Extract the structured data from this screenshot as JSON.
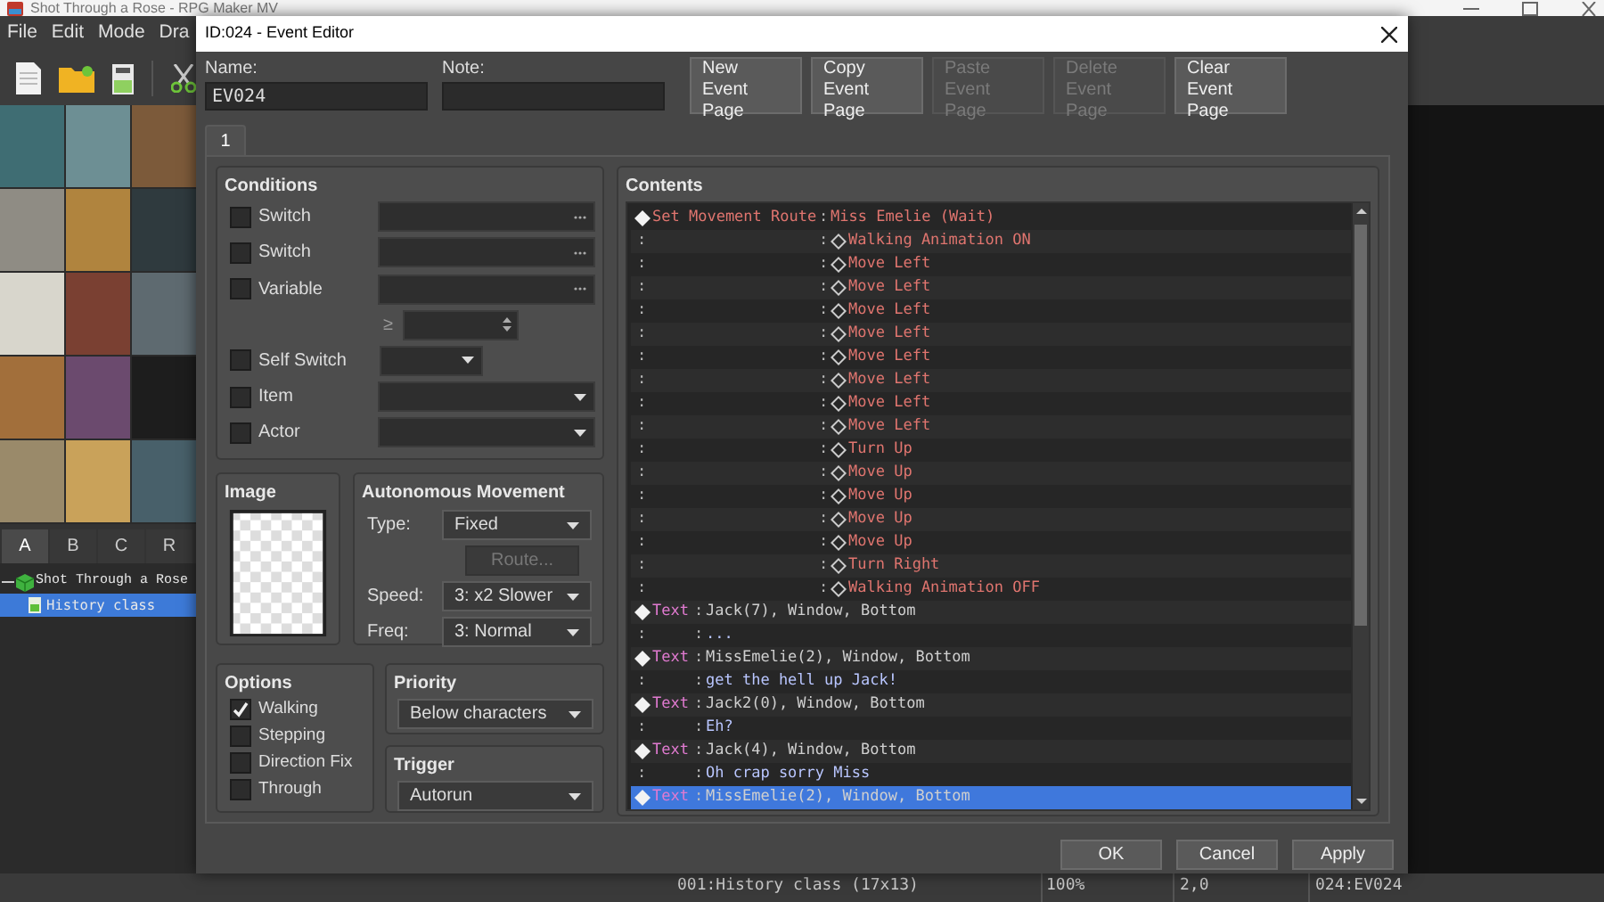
{
  "app": {
    "title": "Shot Through a Rose - RPG Maker MV",
    "menu": [
      "File",
      "Edit",
      "Mode",
      "Dra"
    ],
    "tileset_tabs": [
      {
        "label": "A",
        "selected": true
      },
      {
        "label": "B",
        "selected": false
      },
      {
        "label": "C",
        "selected": false
      },
      {
        "label": "R",
        "selected": false
      }
    ],
    "map_tree": [
      {
        "label": "Shot Through a Rose",
        "expanded": true,
        "selected": false,
        "children": [
          {
            "label": "History class",
            "selected": true
          }
        ]
      }
    ],
    "status_bar": [
      "001:History class (17x13)",
      "100%",
      "2,0",
      "024:EV024"
    ]
  },
  "dialog": {
    "title": "ID:024 - Event Editor",
    "name_label": "Name:",
    "name": "EV024",
    "note_label": "Note:",
    "page_buttons": [
      {
        "label": "New\nEvent Page",
        "disabled": false
      },
      {
        "label": "Copy\nEvent Page",
        "disabled": false
      },
      {
        "label": "Paste\nEvent Page",
        "disabled": true
      },
      {
        "label": "Delete\nEvent Page",
        "disabled": true
      },
      {
        "label": "Clear\nEvent Page",
        "disabled": false
      }
    ],
    "page_tabs": [
      {
        "label": "1",
        "selected": true
      }
    ],
    "conditions": {
      "title": "Conditions",
      "items": [
        {
          "kind": "picker",
          "label": "Switch",
          "checked": false
        },
        {
          "kind": "picker",
          "label": "Switch",
          "checked": false
        },
        {
          "kind": "picker",
          "label": "Variable",
          "checked": false,
          "comparator": "≥"
        },
        {
          "kind": "short_select",
          "label": "Self Switch",
          "checked": false
        },
        {
          "kind": "select",
          "label": "Item",
          "checked": false
        },
        {
          "kind": "select",
          "label": "Actor",
          "checked": false
        }
      ]
    },
    "image": {
      "title": "Image"
    },
    "autonomous_movement": {
      "title": "Autonomous Movement",
      "fields": [
        {
          "kind": "select",
          "label": "Type:",
          "value": "Fixed"
        },
        {
          "kind": "button",
          "label": "Route...",
          "disabled": true
        },
        {
          "kind": "select",
          "label": "Speed:",
          "value": "3: x2 Slower"
        },
        {
          "kind": "select",
          "label": "Freq:",
          "value": "3: Normal"
        }
      ]
    },
    "options": {
      "title": "Options",
      "items": [
        {
          "label": "Walking",
          "checked": true
        },
        {
          "label": "Stepping",
          "checked": false
        },
        {
          "label": "Direction Fix",
          "checked": false
        },
        {
          "label": "Through",
          "checked": false
        }
      ]
    },
    "priority": {
      "title": "Priority",
      "value": "Below characters"
    },
    "trigger": {
      "title": "Trigger",
      "value": "Autorun"
    },
    "contents": {
      "title": "Contents",
      "rows": [
        {
          "kind": "route_header",
          "label": "Set Movement Route",
          "separator": ":",
          "value": "Miss Emelie (Wait)",
          "selected": false
        },
        {
          "kind": "route_step",
          "lead": ":",
          "separator": ":",
          "value": "Walking Animation ON",
          "selected": false
        },
        {
          "kind": "route_step",
          "lead": ":",
          "separator": ":",
          "value": "Move Left",
          "selected": false
        },
        {
          "kind": "route_step",
          "lead": ":",
          "separator": ":",
          "value": "Move Left",
          "selected": false
        },
        {
          "kind": "route_step",
          "lead": ":",
          "separator": ":",
          "value": "Move Left",
          "selected": false
        },
        {
          "kind": "route_step",
          "lead": ":",
          "separator": ":",
          "value": "Move Left",
          "selected": false
        },
        {
          "kind": "route_step",
          "lead": ":",
          "separator": ":",
          "value": "Move Left",
          "selected": false
        },
        {
          "kind": "route_step",
          "lead": ":",
          "separator": ":",
          "value": "Move Left",
          "selected": false
        },
        {
          "kind": "route_step",
          "lead": ":",
          "separator": ":",
          "value": "Move Left",
          "selected": false
        },
        {
          "kind": "route_step",
          "lead": ":",
          "separator": ":",
          "value": "Move Left",
          "selected": false
        },
        {
          "kind": "route_step",
          "lead": ":",
          "separator": ":",
          "value": "Turn Up",
          "selected": false
        },
        {
          "kind": "route_step",
          "lead": ":",
          "separator": ":",
          "value": "Move Up",
          "selected": false
        },
        {
          "kind": "route_step",
          "lead": ":",
          "separator": ":",
          "value": "Move Up",
          "selected": false
        },
        {
          "kind": "route_step",
          "lead": ":",
          "separator": ":",
          "value": "Move Up",
          "selected": false
        },
        {
          "kind": "route_step",
          "lead": ":",
          "separator": ":",
          "value": "Move Up",
          "selected": false
        },
        {
          "kind": "route_step",
          "lead": ":",
          "separator": ":",
          "value": "Turn Right",
          "selected": false
        },
        {
          "kind": "route_step",
          "lead": ":",
          "separator": ":",
          "value": "Walking Animation OFF",
          "selected": false
        },
        {
          "kind": "text_header",
          "label": "Text",
          "separator": ":",
          "value": "Jack(7), Window, Bottom",
          "selected": false
        },
        {
          "kind": "text_line",
          "lead": ":",
          "separator": ":",
          "value": "...",
          "selected": false
        },
        {
          "kind": "text_header",
          "label": "Text",
          "separator": ":",
          "value": "MissEmelie(2), Window, Bottom",
          "selected": false
        },
        {
          "kind": "text_line",
          "lead": ":",
          "separator": ":",
          "value": "get the hell up Jack!",
          "selected": false
        },
        {
          "kind": "text_header",
          "label": "Text",
          "separator": ":",
          "value": "Jack2(0), Window, Bottom",
          "selected": false
        },
        {
          "kind": "text_line",
          "lead": ":",
          "separator": ":",
          "value": "Eh?",
          "selected": false
        },
        {
          "kind": "text_header",
          "label": "Text",
          "separator": ":",
          "value": "Jack(4), Window, Bottom",
          "selected": false
        },
        {
          "kind": "text_line",
          "lead": ":",
          "separator": ":",
          "value": "Oh crap sorry Miss",
          "selected": false
        },
        {
          "kind": "text_header",
          "label": "Text",
          "separator": ":",
          "value": "MissEmelie(2), Window, Bottom",
          "selected": true
        }
      ]
    },
    "buttons": [
      "OK",
      "Cancel",
      "Apply"
    ]
  }
}
